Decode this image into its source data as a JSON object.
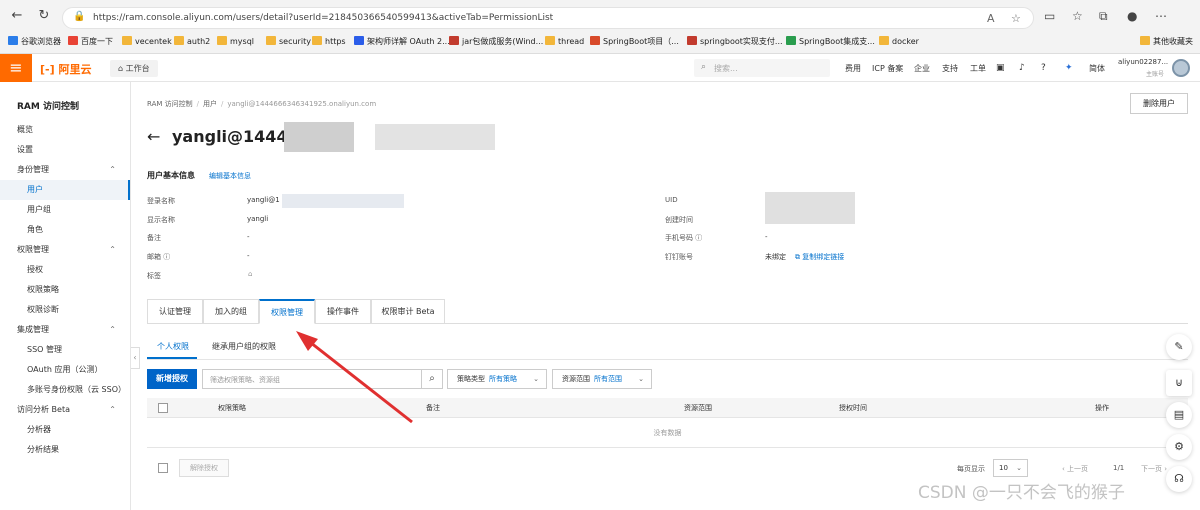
{
  "browser": {
    "url": "https://ram.console.aliyun.com/users/detail?userId=218450366540599413&activeTab=PermissionList",
    "bookmarks": [
      "谷歌浏览器",
      "百度一下",
      "vecentek",
      "auth2",
      "mysql",
      "security",
      "https",
      "架构师详解 OAuth 2...",
      "jar包做成服务(Wind...",
      "thread",
      "SpringBoot项目（...",
      "springboot实现支付...",
      "SpringBoot集成支...",
      "docker"
    ],
    "other_bookmarks": "其他收藏夹"
  },
  "topbar": {
    "logo": "阿里云",
    "workspace": "工作台",
    "search_placeholder": "搜索...",
    "nav": [
      "费用",
      "ICP 备案",
      "企业",
      "支持",
      "工单"
    ],
    "lang": "简体",
    "account": "aliyun02287...",
    "account_role": "主账号"
  },
  "sidebar": {
    "title": "RAM 访问控制",
    "items": [
      {
        "label": "概览",
        "level": 1
      },
      {
        "label": "设置",
        "level": 1
      },
      {
        "label": "身份管理",
        "level": 1,
        "group": true
      },
      {
        "label": "用户",
        "level": 2,
        "active": true
      },
      {
        "label": "用户组",
        "level": 2
      },
      {
        "label": "角色",
        "level": 2
      },
      {
        "label": "权限管理",
        "level": 1,
        "group": true
      },
      {
        "label": "授权",
        "level": 2
      },
      {
        "label": "权限策略",
        "level": 2
      },
      {
        "label": "权限诊断",
        "level": 2
      },
      {
        "label": "集成管理",
        "level": 1,
        "group": true
      },
      {
        "label": "SSO 管理",
        "level": 2
      },
      {
        "label": "OAuth 应用（公测）",
        "level": 2
      },
      {
        "label": "多账号身份权限（云 SSO）",
        "level": 2
      },
      {
        "label": "访问分析 Beta",
        "level": 1,
        "group": true
      },
      {
        "label": "分析器",
        "level": 2
      },
      {
        "label": "分析结果",
        "level": 2
      }
    ]
  },
  "breadcrumb": [
    "RAM 访问控制",
    "用户",
    "yangli@1444666346341925.onaliyun.com"
  ],
  "header": {
    "title": "yangli@14446",
    "delete_button": "删除用户"
  },
  "basic_info": {
    "title": "用户基本信息",
    "edit_link": "编辑基本信息",
    "fields_left": [
      {
        "label": "登录名称",
        "value": "yangli@1"
      },
      {
        "label": "显示名称",
        "value": "yangli"
      },
      {
        "label": "备注",
        "value": "-"
      },
      {
        "label": "邮箱",
        "value": "-"
      },
      {
        "label": "标签",
        "value": ""
      }
    ],
    "fields_right": [
      {
        "label": "UID",
        "value": ""
      },
      {
        "label": "创建时间",
        "value": ""
      },
      {
        "label": "手机号码",
        "value": "-"
      },
      {
        "label": "钉钉账号",
        "value": "未绑定"
      }
    ],
    "copy_bind_link": "复制绑定链接"
  },
  "tabs": [
    "认证管理",
    "加入的组",
    "权限管理",
    "操作事件",
    "权限审计 Beta"
  ],
  "subtabs": [
    "个人权限",
    "继承用户组的权限"
  ],
  "toolbar": {
    "new_grant": "新增授权",
    "filter_placeholder": "筛选权限策略、资源组",
    "policy_type_label": "策略类型",
    "policy_type_value": "所有策略",
    "scope_label": "资源范围",
    "scope_value": "所有范围"
  },
  "table": {
    "columns": [
      "权限策略",
      "备注",
      "资源范围",
      "授权时间",
      "操作"
    ],
    "empty_text": "没有数据"
  },
  "footer": {
    "detach_button": "解除授权",
    "page_size_label": "每页显示",
    "page_size": "10",
    "prev": "上一页",
    "page_info": "1/1",
    "next": "下一页"
  },
  "watermark": "CSDN @一只不会飞的猴子",
  "colors": {
    "brand": "#ff6a00",
    "link": "#0070cc",
    "primary": "#0064c8",
    "arrow": "#e03030"
  }
}
